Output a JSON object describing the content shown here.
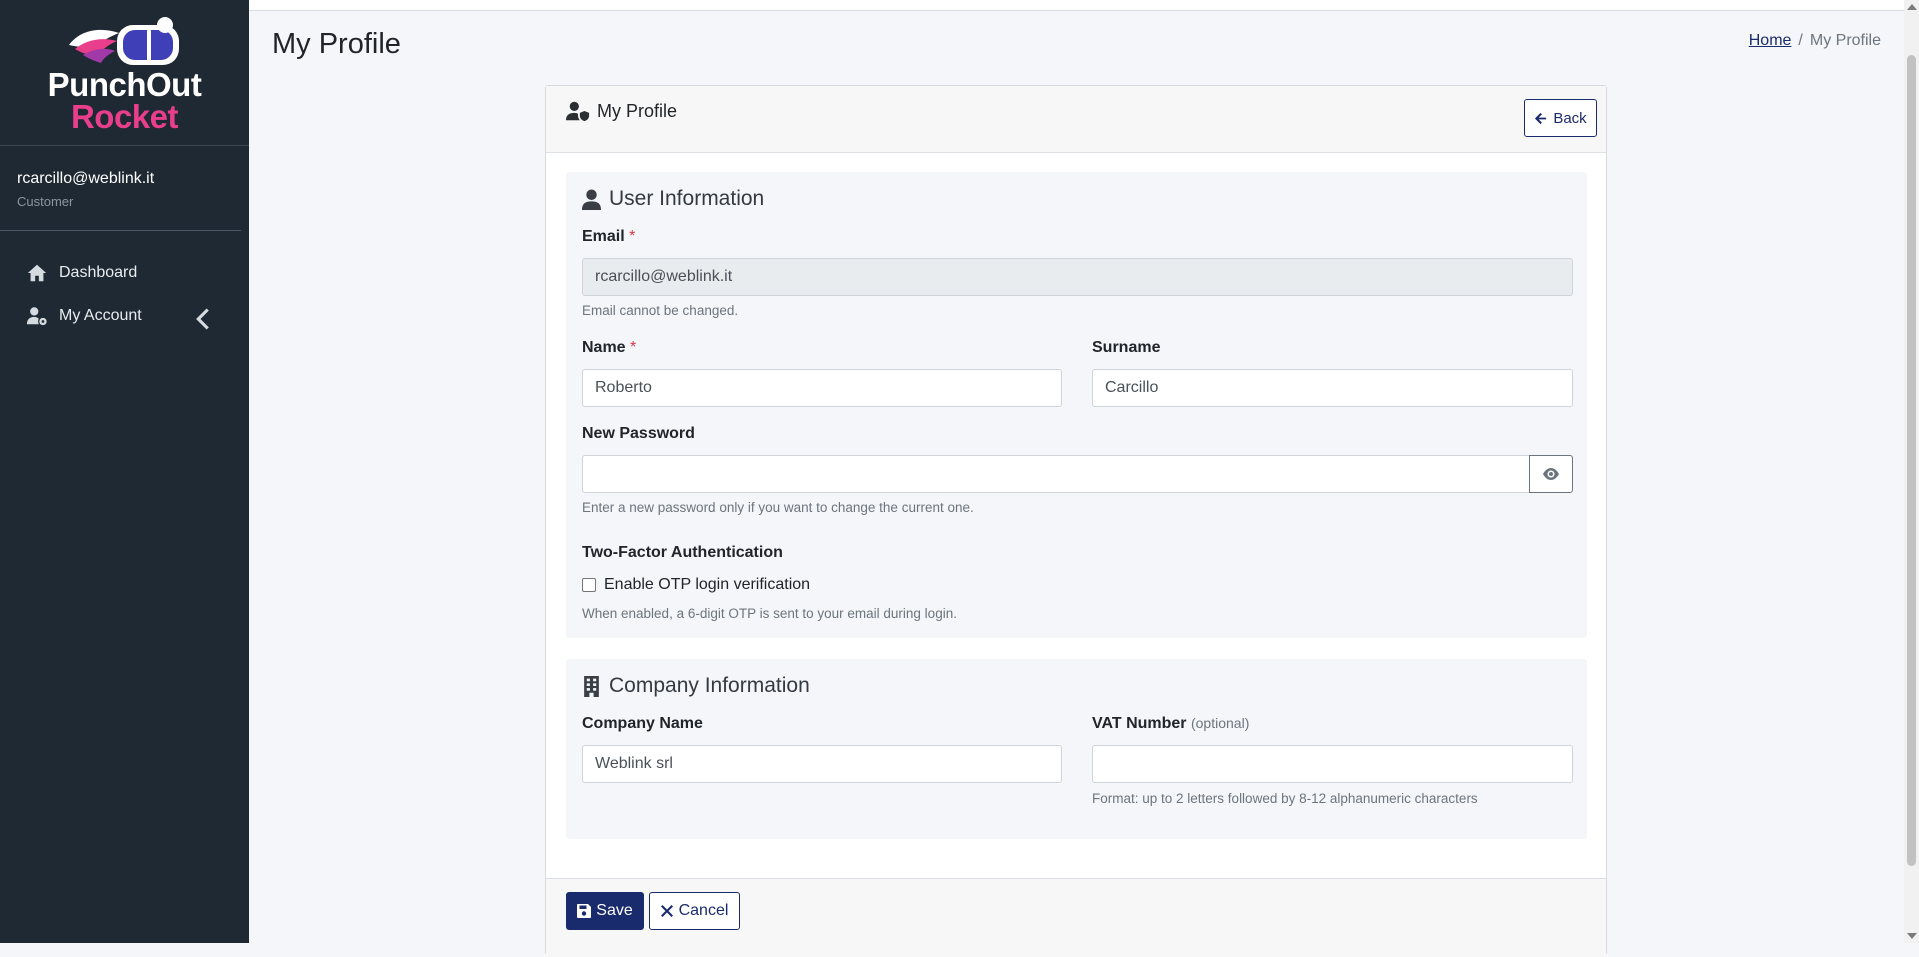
{
  "sidebar": {
    "brand": {
      "line1": "PunchOut",
      "line2": "Rocket",
      "accent_color": "#e83e8c"
    },
    "user": {
      "email": "rcarcillo@weblink.it",
      "role": "Customer"
    },
    "items": [
      {
        "label": "Dashboard",
        "icon": "home-icon"
      },
      {
        "label": "My Account",
        "icon": "user-gear-icon"
      }
    ]
  },
  "header": {
    "title": "My Profile",
    "breadcrumb": {
      "home": "Home",
      "separator": "/",
      "current": "My Profile"
    }
  },
  "card": {
    "title": "My Profile",
    "back_label": "Back",
    "user_section": {
      "title": "User Information",
      "email_label": "Email",
      "required_mark": "*",
      "email_value": "rcarcillo@weblink.it",
      "email_help": "Email cannot be changed.",
      "name_label": "Name",
      "name_value": "Roberto",
      "surname_label": "Surname",
      "surname_value": "Carcillo",
      "password_label": "New Password",
      "password_value": "",
      "password_help": "Enter a new password only if you want to change the current one.",
      "twofa_label": "Two-Factor Authentication",
      "otp_label": "Enable OTP login verification",
      "otp_checked": false,
      "otp_help": "When enabled, a 6-digit OTP is sent to your email during login."
    },
    "company_section": {
      "title": "Company Information",
      "company_label": "Company Name",
      "company_value": "Weblink srl",
      "vat_label": "VAT Number",
      "vat_optional": "(optional)",
      "vat_value": "",
      "vat_help": "Format: up to 2 letters followed by 8-12 alphanumeric characters"
    },
    "footer": {
      "save_label": "Save",
      "cancel_label": "Cancel"
    }
  },
  "colors": {
    "primary": "#1a2b6d",
    "sidebar_bg": "#1f2933",
    "required": "#dc3545"
  }
}
